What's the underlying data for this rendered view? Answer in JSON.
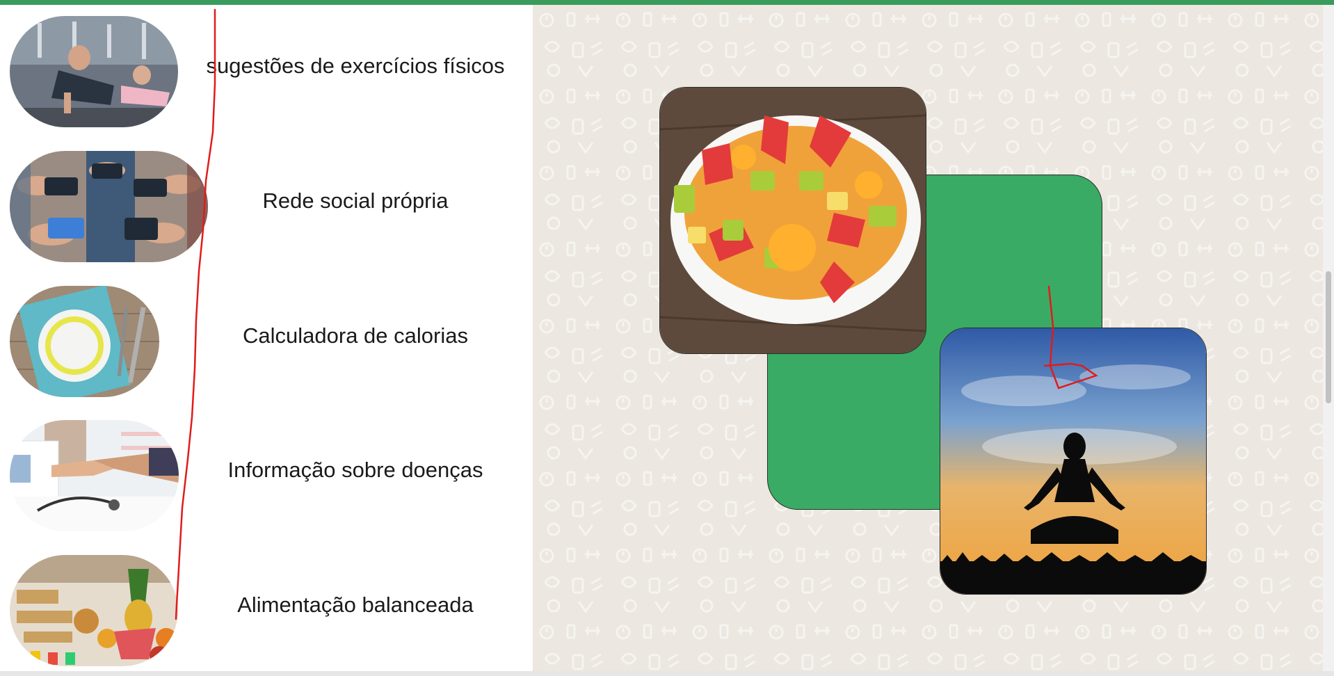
{
  "colors": {
    "accent_green": "#3a9c5c",
    "card_green": "#39ab64",
    "pattern_bg": "#ece7e0",
    "annotation_red": "#e11b1b"
  },
  "features": [
    {
      "label": "sugestões de exercícios físicos",
      "icon": "gym-workout-photo"
    },
    {
      "label": "Rede social própria",
      "icon": "smartphones-photo"
    },
    {
      "label": "Calculadora de calorias",
      "icon": "diet-plate-photo"
    },
    {
      "label": "Informação sobre doenças",
      "icon": "doctor-handshake-photo"
    },
    {
      "label": "Alimentação balanceada",
      "icon": "food-buffet-photo"
    }
  ],
  "showcase": {
    "images": [
      "fruit-salad-bowl-photo",
      "meditation-sunset-photo"
    ],
    "background_pattern": "fitness-icons-pattern"
  }
}
